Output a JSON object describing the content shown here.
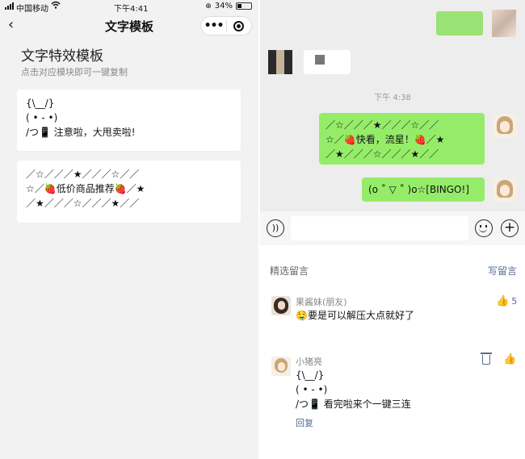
{
  "status_bar": {
    "carrier": "中国移动",
    "time": "下午4:41",
    "battery": "34%",
    "battery_level": 0.34
  },
  "navbar": {
    "title": "文字模板",
    "more": "•••"
  },
  "page": {
    "title": "文字特效模板",
    "subtitle": "点击对应模块即可一键复制"
  },
  "templates": [
    {
      "lines": [
        "{\\__/}",
        "( • - •)",
        "/つ📱 注意啦，大甩卖啦!"
      ]
    },
    {
      "lines": [
        "／☆／／／★／／／☆／／",
        "☆／🍓低价商品推荐🍓／★",
        "／★／／／☆／／／★／／"
      ]
    }
  ],
  "chat": {
    "timestamp": "下午 4:38",
    "bubbles": [
      {
        "lines": [
          "／☆／／／★／／／☆／／",
          "☆／🍓快看，流星！🍓／★",
          "／★／／／☆／／／★／／"
        ]
      },
      {
        "lines": [
          "(o ˚ ▽ ˚ )o☆[BINGO!]"
        ]
      }
    ]
  },
  "comments": {
    "header": "精选留言",
    "write": "写留言",
    "items": [
      {
        "name": "果酱妹(朋友)",
        "lines": [
          "🤤要是可以解压大点就好了"
        ],
        "likes": "5"
      },
      {
        "name": "小猪亮",
        "lines": [
          "{\\__/}",
          "( • - •)",
          "/つ📱 看完啦来个一键三连"
        ],
        "reply": "回复"
      }
    ]
  },
  "icons": {
    "back": "chevron-left-icon",
    "like": "thumbs-up-icon",
    "trash": "trash-icon",
    "voice": "voice-icon",
    "emoji": "emoji-icon",
    "plus": "plus-icon"
  },
  "colors": {
    "bubble": "#95ec69",
    "link": "#576b95",
    "page_bg": "#f2f2f2"
  }
}
